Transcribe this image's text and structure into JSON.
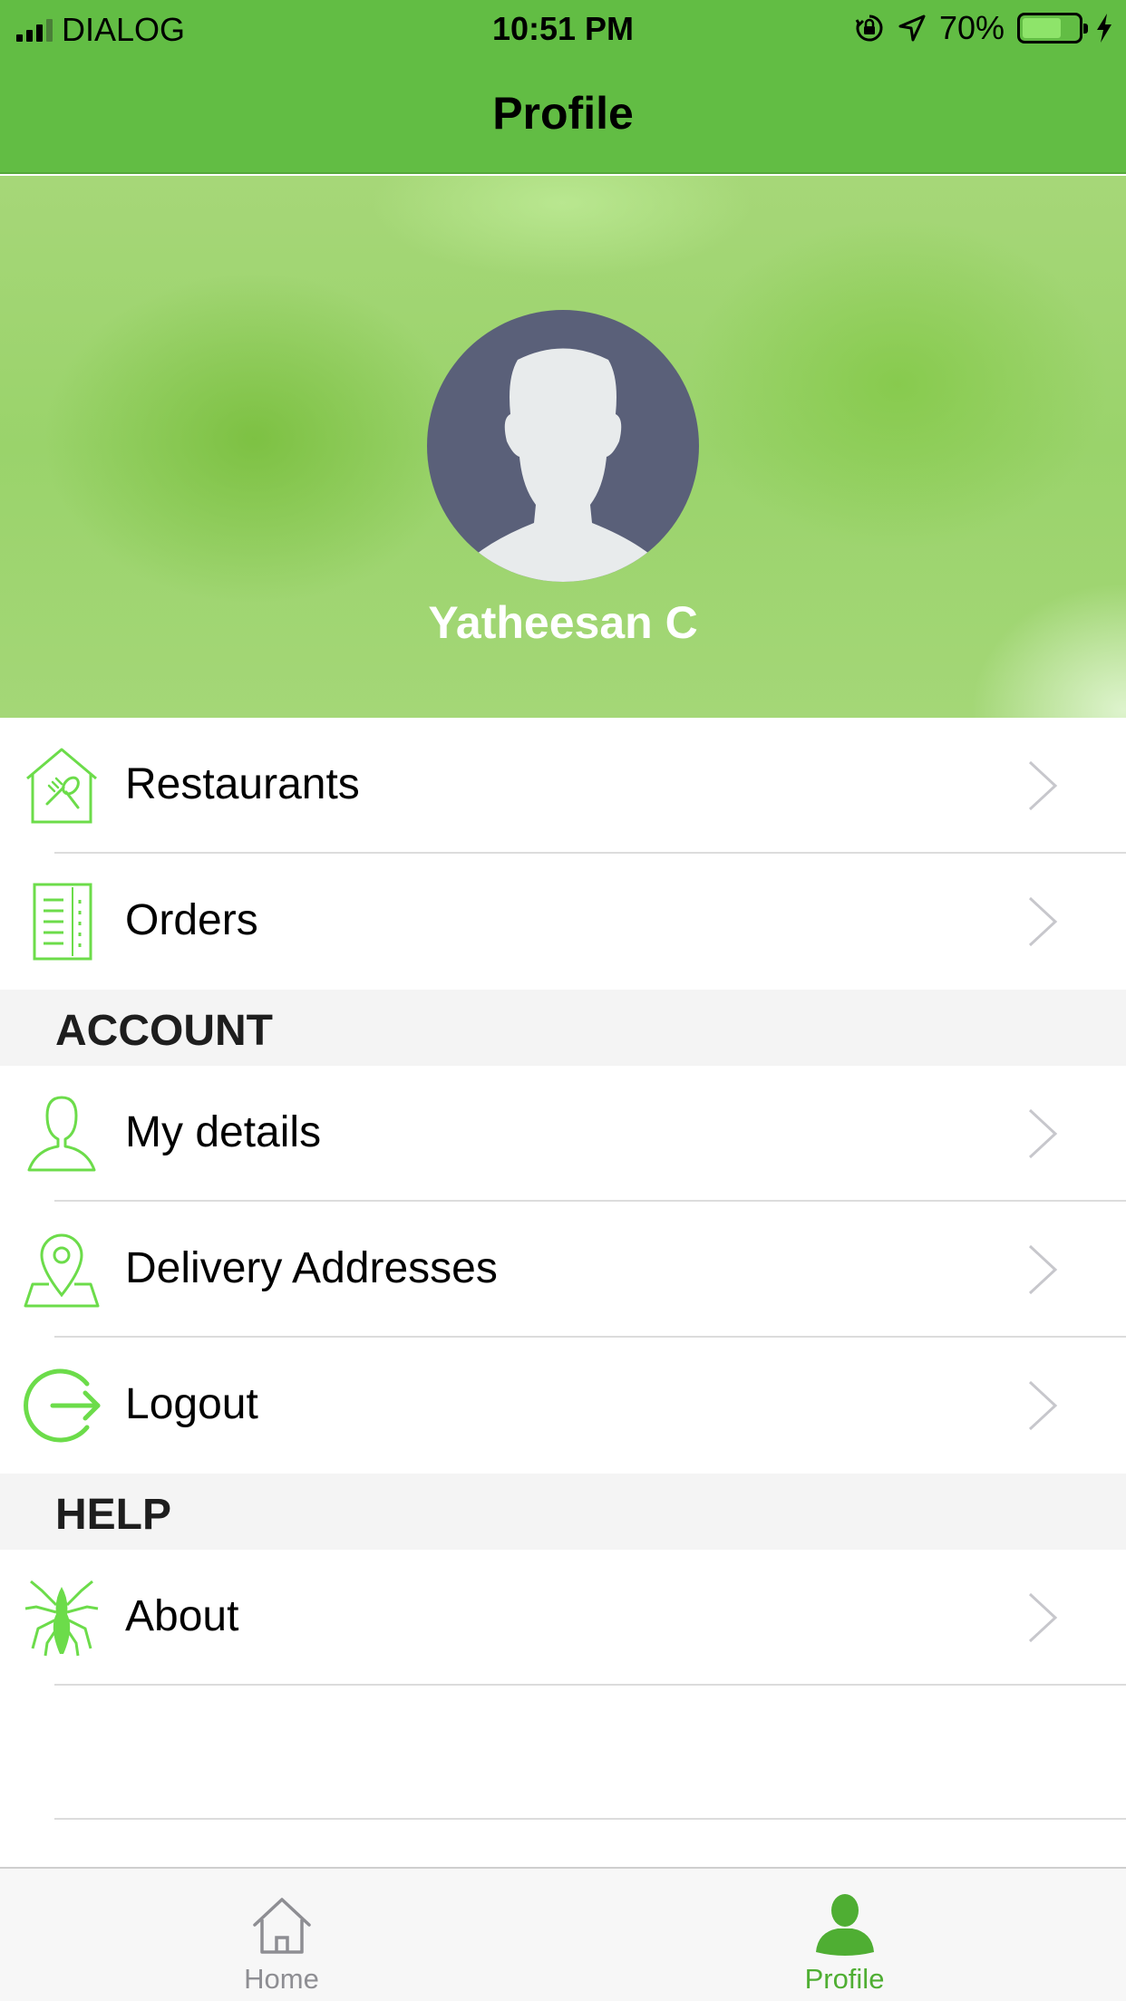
{
  "status_bar": {
    "carrier": "DIALOG",
    "time": "10:51 PM",
    "battery": "70%",
    "battery_level": 0.7,
    "icons": [
      "signal-icon",
      "orientation-lock-icon",
      "location-arrow-icon",
      "battery-icon",
      "charging-bolt-icon"
    ]
  },
  "nav": {
    "title": "Profile"
  },
  "profile": {
    "name": "Yatheesan C"
  },
  "menu": {
    "items": [
      {
        "label": "Restaurants",
        "icon": "restaurant-icon"
      },
      {
        "label": "Orders",
        "icon": "orders-icon"
      }
    ]
  },
  "account": {
    "title": "ACCOUNT",
    "items": [
      {
        "label": "My details",
        "icon": "user-icon"
      },
      {
        "label": "Delivery Addresses",
        "icon": "location-pin-icon"
      },
      {
        "label": "Logout",
        "icon": "logout-icon"
      }
    ]
  },
  "help": {
    "title": "HELP",
    "items": [
      {
        "label": "About",
        "icon": "spider-icon"
      }
    ]
  },
  "tabs": [
    {
      "label": "Home",
      "icon": "home-icon",
      "active": false
    },
    {
      "label": "Profile",
      "icon": "profile-icon",
      "active": true
    }
  ],
  "colors": {
    "accent": "#62bd44",
    "icon_green": "#6cdc4a",
    "tab_active": "#4fae33",
    "tab_inactive": "#8e8e93",
    "section_bg": "#f4f4f4"
  }
}
